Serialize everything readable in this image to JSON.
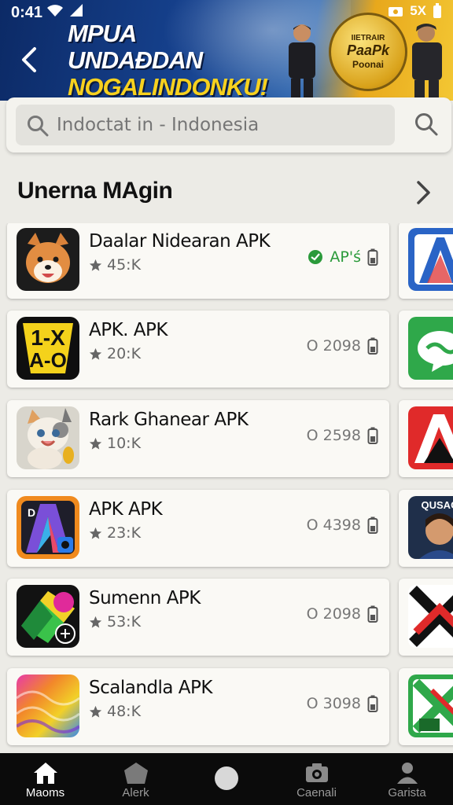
{
  "status_bar": {
    "time": "0:41",
    "right_text": "5X"
  },
  "hero": {
    "title_line1": "MPUA UNDAĐDAN",
    "title_line2": "NOGALINDONKU!",
    "badge_line1": "IIETRAIR",
    "badge_line2": "PaaPk",
    "badge_line3": "Poonai"
  },
  "search": {
    "placeholder": "Indoctat in - Indonesia"
  },
  "section": {
    "title": "Unerna MAgin"
  },
  "apps": [
    {
      "name": "Daalar Nidearan APK",
      "rating": "45:K",
      "meta": "AP'ś",
      "meta_style": "green",
      "icon": "shiba-dog-icon"
    },
    {
      "name": "APK. APK",
      "rating": "20:K",
      "meta": "O 2098",
      "meta_style": "gray",
      "icon": "1x-ao-icon"
    },
    {
      "name": "Rark Ghanear APK",
      "rating": "10:K",
      "meta": "O 2598",
      "meta_style": "gray",
      "icon": "cat-icon"
    },
    {
      "name": "APK APK",
      "rating": "23:K",
      "meta": "O 4398",
      "meta_style": "gray",
      "icon": "letter-a-icon"
    },
    {
      "name": "Sumenn APK",
      "rating": "53:K",
      "meta": "O 2098",
      "meta_style": "gray",
      "icon": "colorful-shapes-icon"
    },
    {
      "name": "Scalandla APK",
      "rating": "48:K",
      "meta": "O 3098",
      "meta_style": "gray",
      "icon": "gradient-waves-icon"
    }
  ],
  "side_apps": [
    {
      "icon": "blue-a-icon"
    },
    {
      "icon": "green-chat-icon"
    },
    {
      "icon": "red-a-icon"
    },
    {
      "icon": "person-icon",
      "label": "QUSAC"
    },
    {
      "icon": "red-x-icon"
    },
    {
      "icon": "green-x-icon"
    }
  ],
  "bottom_nav": [
    {
      "label": "Maoms",
      "icon": "home-icon",
      "active": true
    },
    {
      "label": "Alerk",
      "icon": "house-outline-icon",
      "active": false
    },
    {
      "label": "",
      "icon": "circle-icon",
      "active": false
    },
    {
      "label": "Caenali",
      "icon": "camera-icon",
      "active": false
    },
    {
      "label": "Garista",
      "icon": "profile-icon",
      "active": false
    }
  ],
  "colors": {
    "accent_green": "#2a9a3a",
    "nav_bg": "#0b0b0b",
    "hero_yellow": "#f7d11e"
  }
}
